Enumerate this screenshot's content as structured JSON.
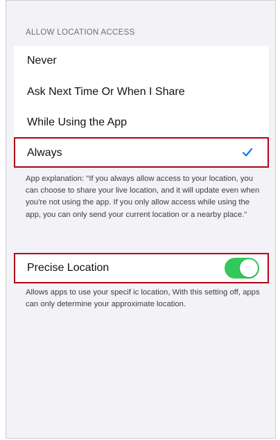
{
  "location_access": {
    "header": "ALLOW LOCATION ACCESS",
    "options": [
      {
        "label": "Never",
        "selected": false
      },
      {
        "label": "Ask Next Time Or When I Share",
        "selected": false
      },
      {
        "label": "While Using the App",
        "selected": false
      },
      {
        "label": "Always",
        "selected": true
      }
    ],
    "explanation": "App explanation: \"If you always allow access to your location, you can choose to share your live location,  and it will update even when you're not using the app. If you only allow access while using the app, you can only send your current location or a nearby place.\""
  },
  "precise_location": {
    "label": "Precise Location",
    "enabled": true,
    "description": "Allows apps to use your specif ic location, With this setting off, apps can only determine your approximate location."
  },
  "colors": {
    "background": "#f2f2f7",
    "checkmark": "#007aff",
    "toggle_on": "#34c759",
    "highlight": "#b3001b"
  },
  "icons": {
    "selected_marker": "checkmark-icon"
  }
}
